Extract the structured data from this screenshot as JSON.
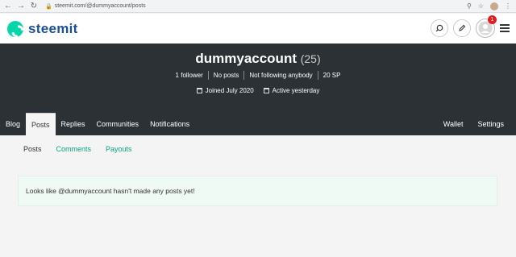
{
  "browser": {
    "url": "steemit.com/@dummyaccount/posts"
  },
  "header": {
    "logo_text": "steemit",
    "notification_count": "1",
    "brand_color": "#06d6a9"
  },
  "profile": {
    "name": "dummyaccount",
    "reputation": "(25)",
    "stats": [
      "1 follower",
      "No posts",
      "Not following anybody",
      "20 SP"
    ],
    "joined": "Joined July 2020",
    "active": "Active yesterday"
  },
  "tabs": {
    "left": [
      "Blog",
      "Posts",
      "Replies",
      "Communities",
      "Notifications"
    ],
    "right": [
      "Wallet",
      "Settings"
    ],
    "active": "Posts"
  },
  "subtabs": {
    "items": [
      "Posts",
      "Comments",
      "Payouts"
    ],
    "active": "Posts"
  },
  "notice": {
    "text": "Looks like @dummyaccount hasn't made any posts yet!"
  }
}
